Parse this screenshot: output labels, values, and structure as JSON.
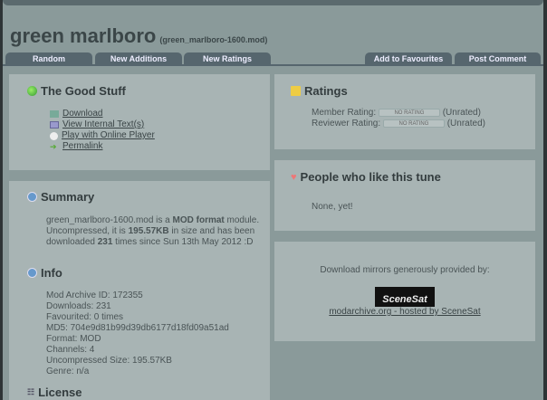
{
  "title": "green marlboro",
  "filename": "(green_marlboro-1600.mod)",
  "tabs_left": [
    "Random",
    "New Additions",
    "New Ratings"
  ],
  "tabs_right": [
    "Add to Favourites",
    "Post Comment"
  ],
  "good_stuff": {
    "heading": "The Good Stuff",
    "links": [
      "Download",
      "View Internal Text(s)",
      "Play with Online Player",
      "Permalink"
    ]
  },
  "summary": {
    "heading": "Summary",
    "t1": "green_marlboro-1600.mod is a ",
    "b1": "MOD format",
    "t2": " module. Uncompressed, it is ",
    "b2": "195.57KB",
    "t3": " in size and has been downloaded ",
    "b3": "231",
    "t4": " times since Sun 13th May 2012 :D"
  },
  "info": {
    "heading": "Info",
    "lines": [
      "Mod Archive ID: 172355",
      "Downloads: 231",
      "Favourited: 0 times",
      "MD5: 704e9d81b99d39db6177d18fd09a51ad",
      "Format: MOD",
      "Channels: 4",
      "Uncompressed Size: 195.57KB",
      "Genre: n/a"
    ]
  },
  "license": {
    "heading": "License"
  },
  "ratings": {
    "heading": "Ratings",
    "member_label": "Member Rating:",
    "reviewer_label": "Reviewer Rating:",
    "badge": "NO RATING",
    "member_value": "(Unrated)",
    "reviewer_value": "(Unrated)"
  },
  "likes": {
    "heading": "People who like this tune",
    "text": "None, yet!"
  },
  "mirrors": {
    "text": "Download mirrors generously provided by:",
    "logo": "SceneSat",
    "link": "modarchive.org - hosted by SceneSat"
  }
}
